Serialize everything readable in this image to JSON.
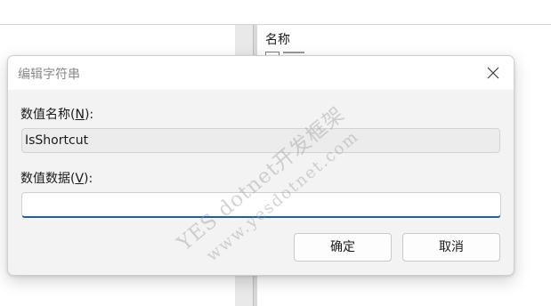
{
  "background": {
    "list_column_header": "名称"
  },
  "dialog": {
    "title": "编辑字符串",
    "value_name": {
      "label_prefix": "数值名称(",
      "label_key": "N",
      "label_suffix": "):",
      "value": "IsShortcut"
    },
    "value_data": {
      "label_prefix": "数值数据(",
      "label_key": "V",
      "label_suffix": "):",
      "value": ""
    },
    "buttons": {
      "ok": "确定",
      "cancel": "取消"
    }
  },
  "watermark": {
    "line1": "YES dotnet开发框架",
    "line2": "www.yesdotnet.com"
  },
  "colors": {
    "focus_underline": "#1f5f9f",
    "dialog_bg": "#f3f3f3"
  }
}
